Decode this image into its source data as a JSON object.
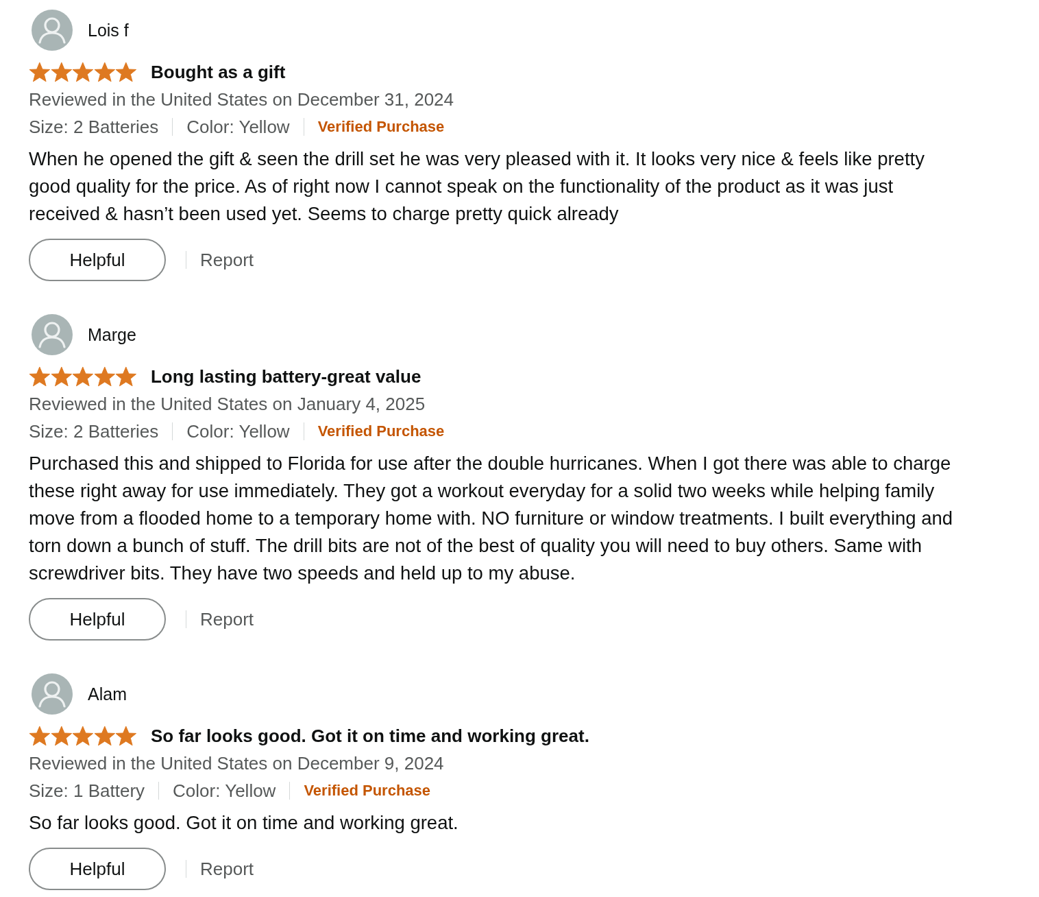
{
  "reviews": [
    {
      "reviewer": "Lois f",
      "stars": 5,
      "title": "Bought as a gift",
      "date_line": "Reviewed in the United States on December 31, 2024",
      "variants": [
        "Size: 2 Batteries",
        "Color: Yellow"
      ],
      "badge": "Verified Purchase",
      "body": "When he opened the gift & seen the drill set he was very pleased with it. It looks very nice & feels like pretty good quality for the price. As of right now I cannot speak on the functionality of the product as it was just received & hasn’t been used yet. Seems to charge pretty quick already",
      "helpful_button": "Helpful",
      "report_link": "Report"
    },
    {
      "reviewer": "Marge",
      "stars": 5,
      "title": "Long lasting battery-great value",
      "date_line": "Reviewed in the United States on January 4, 2025",
      "variants": [
        "Size: 2 Batteries",
        "Color: Yellow"
      ],
      "badge": "Verified Purchase",
      "body": "Purchased this and shipped to Florida for use after the double hurricanes. When I got there was able to charge these right away for use immediately. They got a workout everyday for a solid two weeks while helping family move from a flooded home to a temporary home with. NO furniture or window treatments. I built everything and torn down a bunch of stuff. The drill bits are not of the best of quality you will need to buy others. Same with screwdriver bits. They have two speeds and held up to my abuse.",
      "helpful_button": "Helpful",
      "report_link": "Report"
    },
    {
      "reviewer": "Alam",
      "stars": 5,
      "title": "So far looks good. Got it on time and working great.",
      "date_line": "Reviewed in the United States on December 9, 2024",
      "variants": [
        "Size: 1 Battery",
        "Color: Yellow"
      ],
      "badge": "Verified Purchase",
      "body": "So far looks good. Got it on time and working great.",
      "helpful_button": "Helpful",
      "report_link": "Report"
    }
  ]
}
